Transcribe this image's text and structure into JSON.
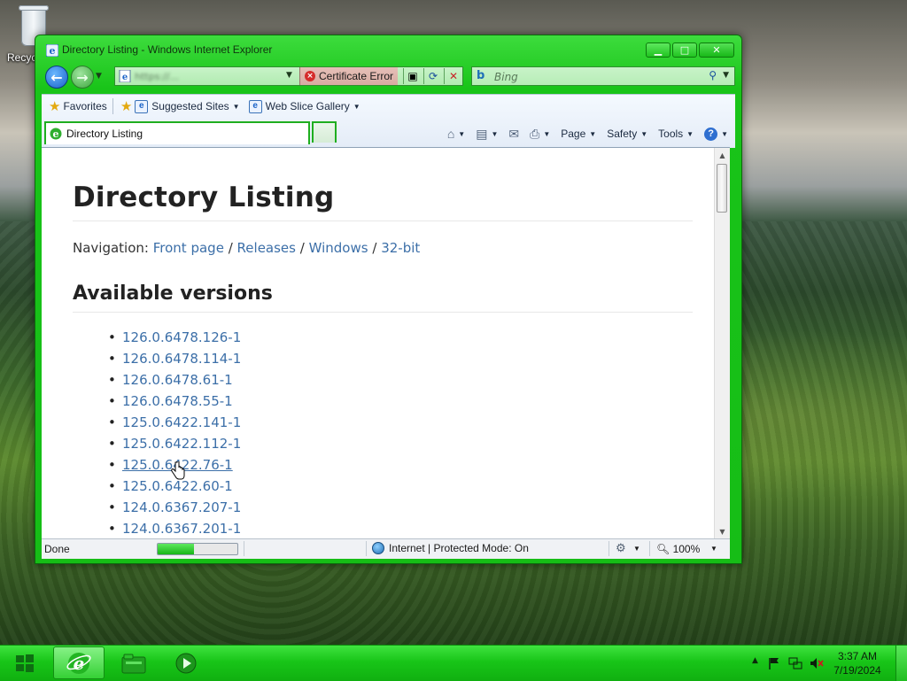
{
  "desktop": {
    "recycle_bin_label": "Recycle Bin"
  },
  "window": {
    "title": "Directory Listing - Windows Internet Explorer",
    "caption_buttons": {
      "minimize": "▁",
      "maximize": "□",
      "close": "✕"
    }
  },
  "navbar": {
    "address_url": "https://...",
    "certificate_error": "Certificate Error",
    "search_placeholder": "Bing",
    "search_provider_icon": "bing-icon"
  },
  "favorites_bar": {
    "favorites_label": "Favorites",
    "items": [
      {
        "label": "Suggested Sites",
        "icon": "ie-page-icon"
      },
      {
        "label": "Web Slice Gallery",
        "icon": "ie-page-icon"
      }
    ]
  },
  "tab": {
    "title": "Directory Listing"
  },
  "command_bar": {
    "page_label": "Page",
    "safety_label": "Safety",
    "tools_label": "Tools",
    "help_label": "?"
  },
  "content": {
    "heading": "Directory Listing",
    "nav_prefix": "Navigation:",
    "breadcrumbs": [
      "Front page",
      "Releases",
      "Windows",
      "32-bit"
    ],
    "breadcrumb_sep": "/",
    "subheading": "Available versions",
    "versions": [
      "126.0.6478.126-1",
      "126.0.6478.114-1",
      "126.0.6478.61-1",
      "126.0.6478.55-1",
      "125.0.6422.141-1",
      "125.0.6422.112-1",
      "125.0.6422.76-1",
      "125.0.6422.60-1",
      "124.0.6367.207-1",
      "124.0.6367.201-1"
    ],
    "hovered_version_index": 6
  },
  "statusbar": {
    "status": "Done",
    "progress_fraction": 0.45,
    "zone": "Internet | Protected Mode: On",
    "zoom": "100%"
  },
  "taskbar": {
    "time": "3:37 AM",
    "date": "7/19/2024",
    "pinned": [
      "internet-explorer-icon",
      "file-explorer-icon",
      "media-player-icon"
    ]
  },
  "colors": {
    "window_frame": "#19c419",
    "taskbar": "#18c518",
    "link": "#3c6fa8",
    "progress": "#17b617"
  }
}
